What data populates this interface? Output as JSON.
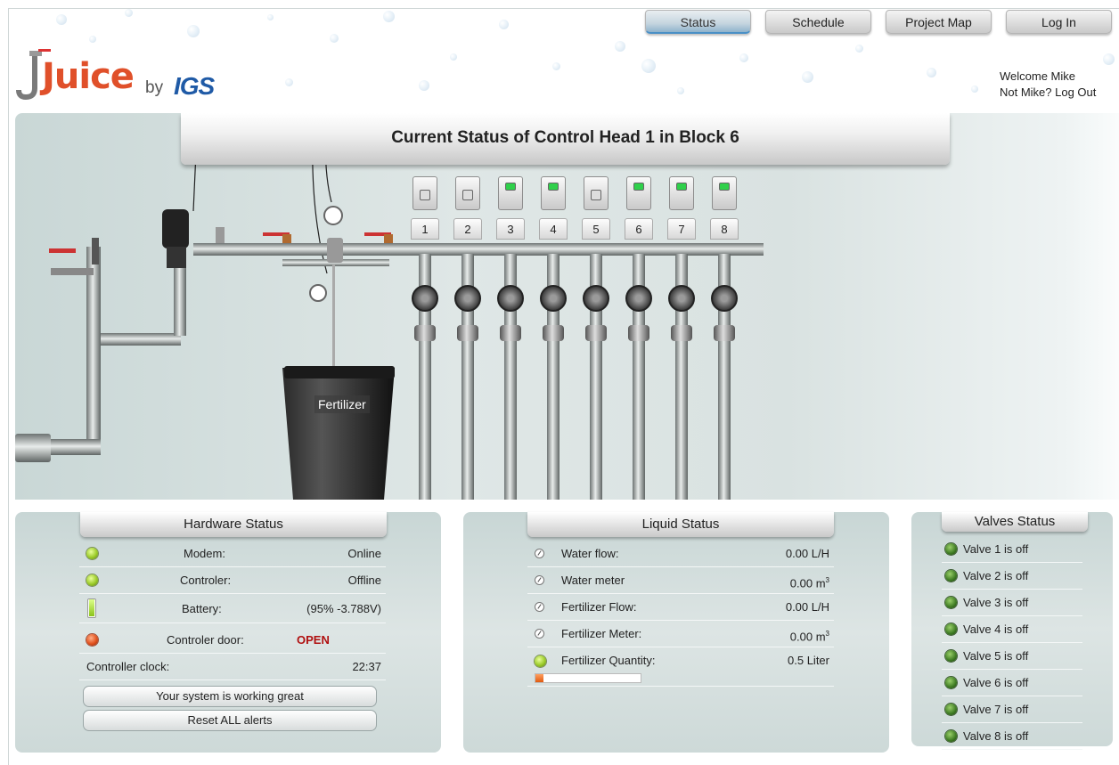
{
  "nav": {
    "status": "Status",
    "schedule": "Schedule",
    "project_map": "Project Map",
    "login": "Log In"
  },
  "logo": {
    "word": "Juice",
    "by": "by",
    "brand": "IGS"
  },
  "user": {
    "welcome": "Welcome Mike",
    "not_me": "Not Mike? Log Out"
  },
  "scene": {
    "title": "Current Status of Control Head 1 in Block 6",
    "fertilizer_label": "Fertilizer",
    "valves": [
      {
        "num": "1",
        "on": false
      },
      {
        "num": "2",
        "on": false
      },
      {
        "num": "3",
        "on": true
      },
      {
        "num": "4",
        "on": true
      },
      {
        "num": "5",
        "on": false
      },
      {
        "num": "6",
        "on": true
      },
      {
        "num": "7",
        "on": true
      },
      {
        "num": "8",
        "on": true
      }
    ]
  },
  "hardware": {
    "title": "Hardware Status",
    "modem_label": "Modem:",
    "modem_value": "Online",
    "controller_label": "Controler:",
    "controller_value": "Offline",
    "battery_label": "Battery:",
    "battery_value": "(95% -3.788V)",
    "battery_level": 0.95,
    "door_label": "Controler door:",
    "door_value": "OPEN",
    "clock_label": "Controller clock:",
    "clock_value": "22:37",
    "status_button": "Your system is working great",
    "reset_button": "Reset ALL alerts"
  },
  "liquid": {
    "title": "Liquid Status",
    "water_flow_label": "Water flow:",
    "water_flow_value": "0.00 L/H",
    "water_meter_label": "Water meter",
    "water_meter_value": "0.00 m",
    "fert_flow_label": "Fertilizer Flow:",
    "fert_flow_value": "0.00 L/H",
    "fert_meter_label": "Fertilizer Meter:",
    "fert_meter_value": "0.00 m",
    "cubic_sup": "3",
    "fert_qty_label": "Fertilizer Quantity:",
    "fert_qty_value": "0.5 Liter",
    "fert_qty_fraction": 0.08
  },
  "valves_status": {
    "title": "Valves Status",
    "items": [
      "Valve 1 is off",
      "Valve 2 is off",
      "Valve 3 is off",
      "Valve 4 is off",
      "Valve 5 is off",
      "Valve 6 is off",
      "Valve 7 is off",
      "Valve 8 is off"
    ]
  },
  "colors": {
    "accent": "#4a90c6",
    "logo_orange": "#e0502a",
    "logo_blue": "#1f5aa6",
    "alert_red": "#b01010"
  }
}
